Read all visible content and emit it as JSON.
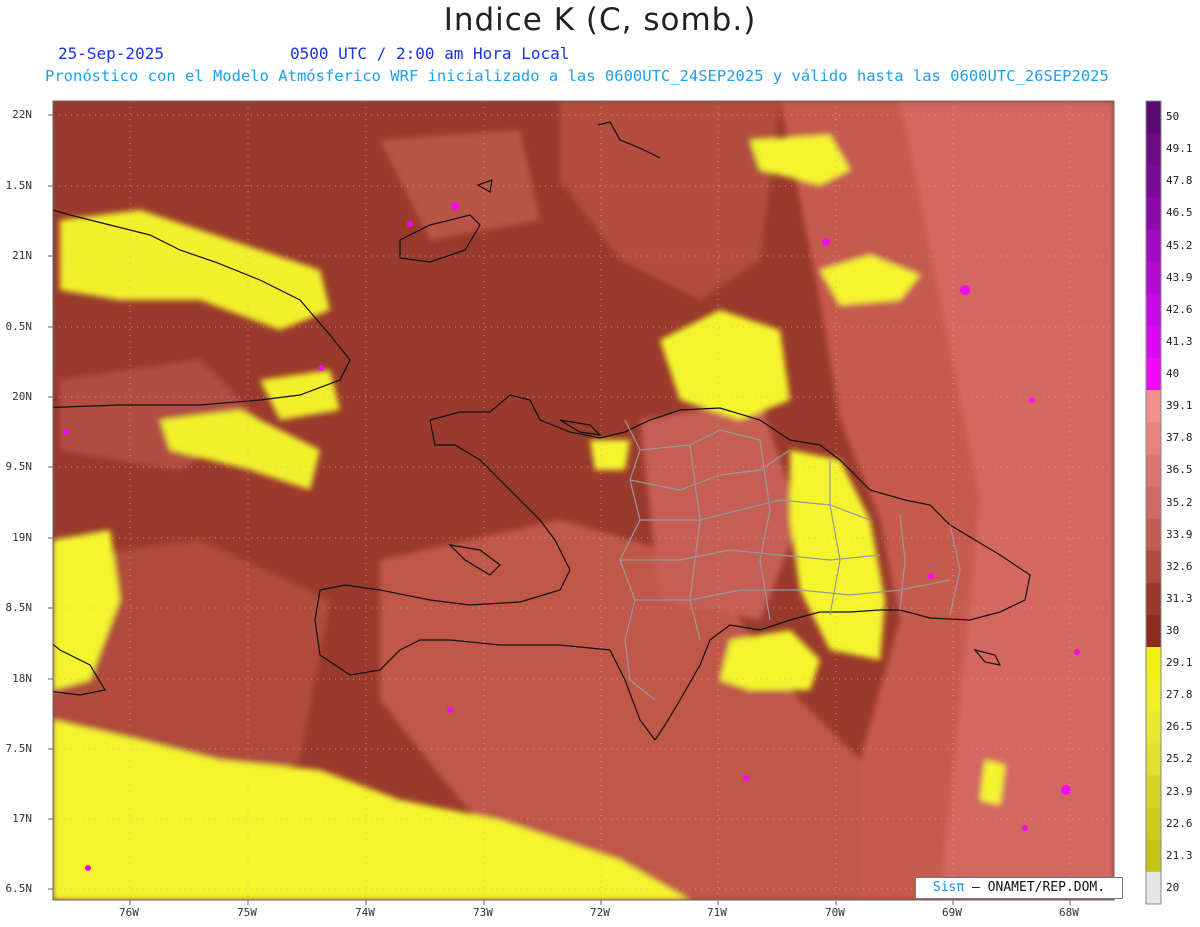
{
  "header": {
    "title": "Indice K (C, somb.)",
    "date": "25-Sep-2025",
    "time": "0500 UTC / 2:00 am Hora Local",
    "forecast_line": "Pronóstico con el Modelo Atmósferico WRF inicializado a las 0600UTC_24SEP2025 y válido hasta las  0600UTC_26SEP2025"
  },
  "axes": {
    "lat_labels": [
      "22N",
      "1.5N",
      "21N",
      "0.5N",
      "20N",
      "9.5N",
      "19N",
      "8.5N",
      "18N",
      "7.5N",
      "17N",
      "6.5N"
    ],
    "lon_labels": [
      "76W",
      "75W",
      "74W",
      "73W",
      "72W",
      "71W",
      "70W",
      "69W",
      "68W"
    ]
  },
  "colorbar": {
    "labels": [
      "50",
      "49.1",
      "47.8",
      "46.5",
      "45.2",
      "43.9",
      "42.6",
      "41.3",
      "40",
      "39.1",
      "37.8",
      "36.5",
      "35.2",
      "33.9",
      "32.6",
      "31.3",
      "30",
      "29.1",
      "27.8",
      "26.5",
      "25.2",
      "23.9",
      "22.6",
      "21.3",
      "20"
    ],
    "colors": [
      "#5a0a6e",
      "#6d0a84",
      "#7a0a96",
      "#8c0aaa",
      "#a00ac0",
      "#b40ad4",
      "#c80ae6",
      "#dc0af0",
      "#f00af8",
      "#f08f8f",
      "#e8837b",
      "#dc7670",
      "#d06a64",
      "#c25c52",
      "#b04a3e",
      "#9a3a2c",
      "#8c2c1e",
      "#f0f014",
      "#f0f028",
      "#e8e830",
      "#e0e030",
      "#d4d428",
      "#cccc20",
      "#c4c418",
      "#e6e6e6"
    ]
  },
  "legend_colors": {
    "base_dark": "#8e3323",
    "mid": "#b24a3c",
    "light": "#d9655c",
    "yellow": "#f5f52e",
    "magenta": "#f00af8"
  },
  "credit": {
    "brand": "Sisπ",
    "text": "– ONAMET/REP.DOM."
  }
}
